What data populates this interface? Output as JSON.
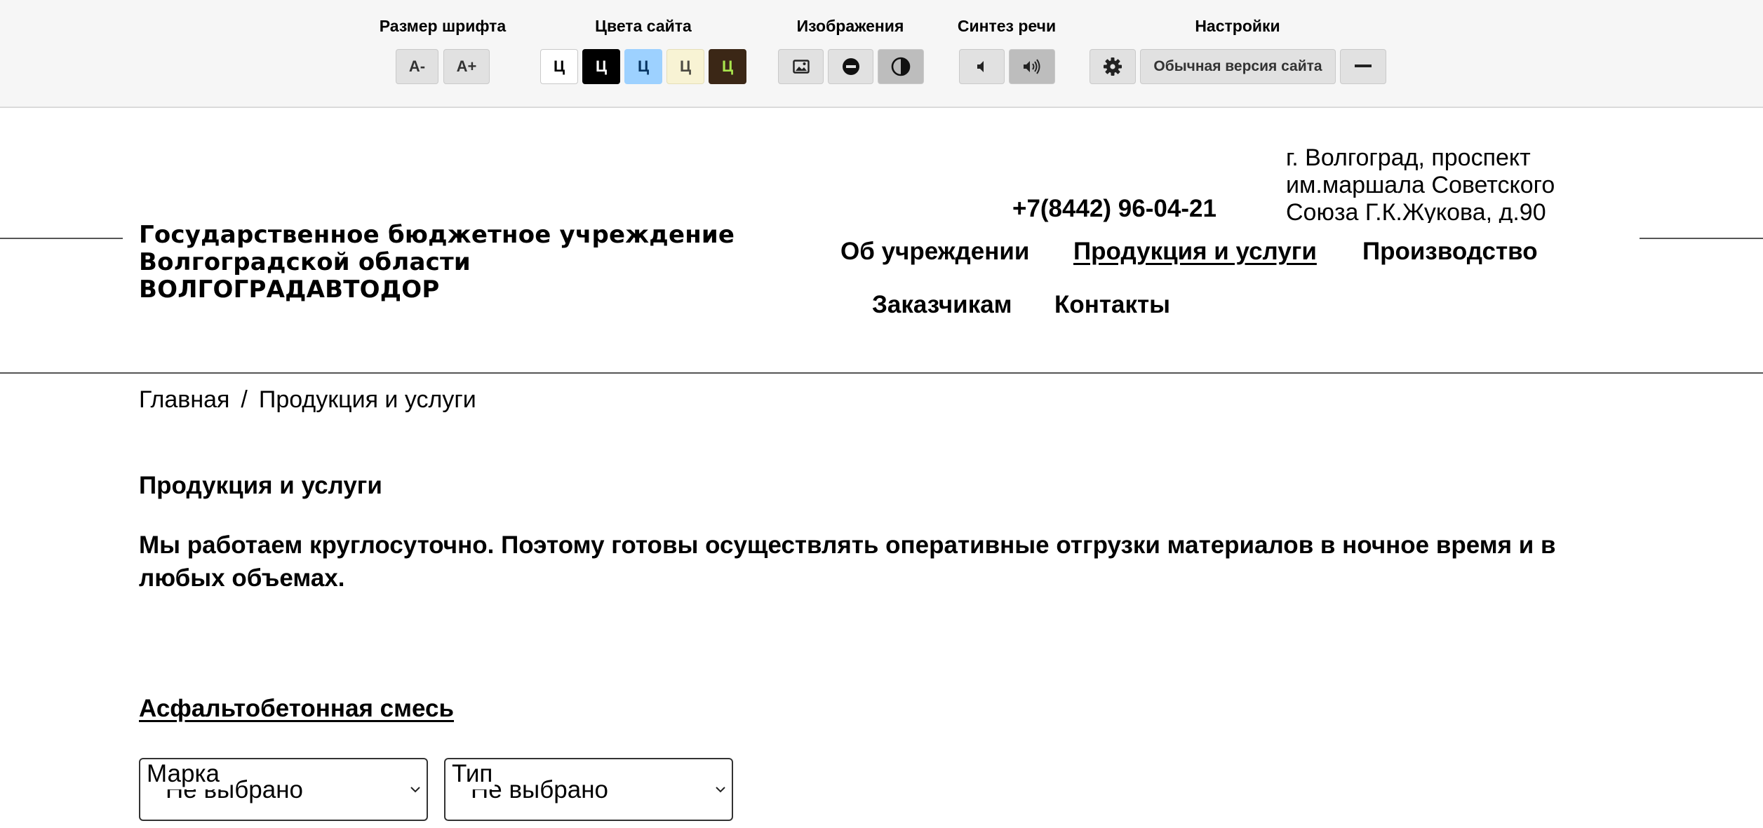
{
  "accessibility_panel": {
    "font_size": {
      "title": "Размер шрифта",
      "decrease_label": "A-",
      "increase_label": "A+"
    },
    "site_colors": {
      "title": "Цвета сайта",
      "schemes": [
        {
          "label": "Ц",
          "background": "#ffffff",
          "text": "#000000"
        },
        {
          "label": "Ц",
          "background": "#000000",
          "text": "#ffffff"
        },
        {
          "label": "Ц",
          "background": "#9dd1ff",
          "text": "#063462"
        },
        {
          "label": "Ц",
          "background": "#f8f3d4",
          "text": "#4d4b43"
        },
        {
          "label": "Ц",
          "background": "#3b2716",
          "text": "#a9e44d"
        }
      ]
    },
    "images": {
      "title": "Изображения",
      "buttons": [
        "image-icon",
        "minus-circle-icon",
        "half-circle-contrast-icon"
      ]
    },
    "speech": {
      "title": "Синтез речи",
      "buttons": [
        "speaker-off-icon",
        "speaker-on-icon"
      ]
    },
    "settings": {
      "title": "Настройки",
      "regular_version_label": "Обычная версия сайта",
      "icons": [
        "gear-icon",
        "minus-icon"
      ]
    }
  },
  "header": {
    "org_name_lines": [
      "Государственное бюджетное учреждение",
      "Волгоградской области",
      "ВОЛГОГРАДАВТОДОР"
    ],
    "phone": "+7(8442) 96-04-21",
    "address": "г. Волгоград, проспект им.маршала Советского Союза Г.К.Жукова, д.90",
    "nav": [
      {
        "label": "Об учреждении",
        "active": false
      },
      {
        "label": "Продукция и услуги",
        "active": true
      },
      {
        "label": "Производство",
        "active": false
      },
      {
        "label": "Заказчикам",
        "active": false
      },
      {
        "label": "Контакты",
        "active": false
      }
    ]
  },
  "breadcrumb": {
    "items": [
      "Главная",
      "Продукция и услуги"
    ],
    "separator": "/"
  },
  "main": {
    "title": "Продукция и услуги",
    "intro": "Мы работаем круглосуточно. Поэтому готовы осуществлять оперативные отгрузки материалов в ночное время и в любых объемах.",
    "section_link": "Асфальтобетонная смесь",
    "filters": [
      {
        "label": "Марка",
        "value": "Не выбрано"
      },
      {
        "label": "Тип",
        "value": "Не выбрано"
      }
    ]
  }
}
